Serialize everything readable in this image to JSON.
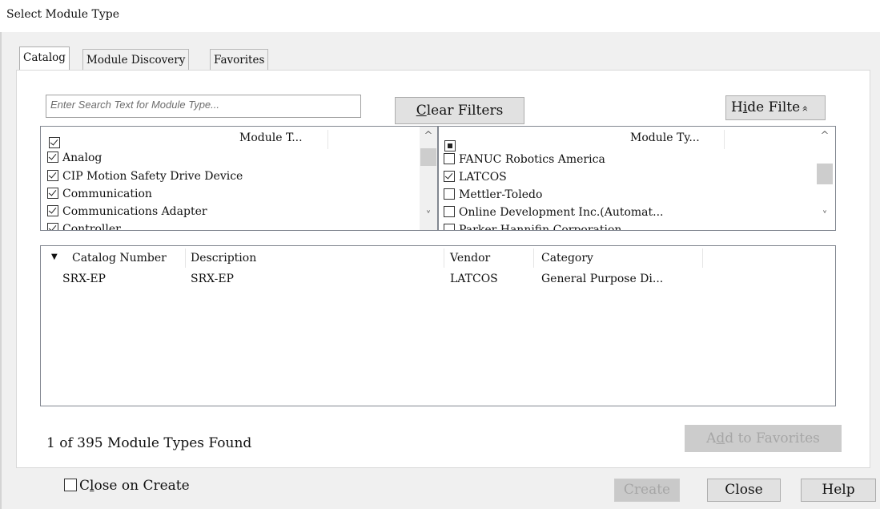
{
  "window": {
    "title": "Select Module Type"
  },
  "tabs": [
    {
      "label": "Catalog",
      "active": true
    },
    {
      "label": "Module Discovery",
      "active": false
    },
    {
      "label": "Favorites",
      "active": false
    }
  ],
  "search": {
    "placeholder": "Enter Search Text for Module Type..."
  },
  "buttons": {
    "clear_filters_accel": "C",
    "clear_filters_rest": "lear Filters",
    "hide_filters_pre": "H",
    "hide_filters_accel": "i",
    "hide_filters_rest": "de Filte",
    "hide_filters_icon": "«",
    "add_to_favorites_pre": "A",
    "add_to_favorites_accel": "d",
    "add_to_favorites_rest": "d to Favorites",
    "create": "Create",
    "close": "Close",
    "help": "Help"
  },
  "category_filter": {
    "header": "Module T...",
    "header_check": "checked",
    "items": [
      {
        "label": "Analog",
        "checked": true
      },
      {
        "label": "CIP Motion Safety Drive Device",
        "checked": true
      },
      {
        "label": "Communication",
        "checked": true
      },
      {
        "label": "Communications Adapter",
        "checked": true
      },
      {
        "label": "Controller",
        "checked": true
      }
    ]
  },
  "vendor_filter": {
    "header": "Module Ty...",
    "header_check": "partial",
    "items": [
      {
        "label": "FANUC Robotics America",
        "checked": false
      },
      {
        "label": "LATCOS",
        "checked": true
      },
      {
        "label": "Mettler-Toledo",
        "checked": false
      },
      {
        "label": "Online Development Inc.(Automat...",
        "checked": false
      },
      {
        "label": "Parker Hannifin Corporation",
        "checked": false
      }
    ]
  },
  "results": {
    "sort_icon": "▼",
    "columns": [
      "Catalog Number",
      "Description",
      "Vendor",
      "Category"
    ],
    "rows": [
      {
        "catalog_number": "SRX-EP",
        "description": "SRX-EP",
        "vendor": "LATCOS",
        "category": "General Purpose Di..."
      }
    ]
  },
  "status": {
    "found": "1 of 395 Module Types Found"
  },
  "close_on_create": {
    "pre": "C",
    "accel": "l",
    "rest": "ose on Create",
    "checked": false
  },
  "scroll_icons": {
    "up": "^",
    "down": "˅"
  }
}
